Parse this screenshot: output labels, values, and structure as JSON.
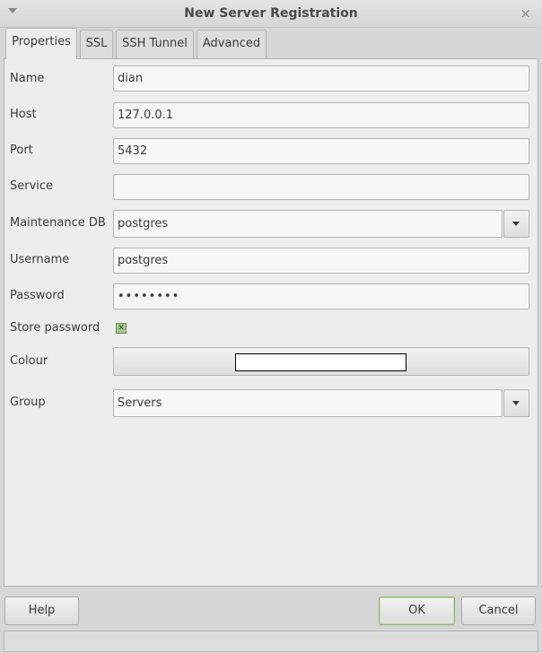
{
  "window": {
    "title": "New Server Registration",
    "close_glyph": "×"
  },
  "tabs": [
    {
      "label": "Properties",
      "active": true
    },
    {
      "label": "SSL",
      "active": false
    },
    {
      "label": "SSH Tunnel",
      "active": false
    },
    {
      "label": "Advanced",
      "active": false
    }
  ],
  "form": {
    "name": {
      "label": "Name",
      "value": "dian"
    },
    "host": {
      "label": "Host",
      "value": "127.0.0.1"
    },
    "port": {
      "label": "Port",
      "value": "5432"
    },
    "service": {
      "label": "Service",
      "value": ""
    },
    "maintenance_db": {
      "label": "Maintenance DB",
      "value": "postgres"
    },
    "username": {
      "label": "Username",
      "value": "postgres"
    },
    "password": {
      "label": "Password",
      "value": "••••••••"
    },
    "store_password": {
      "label": "Store password",
      "checked": true,
      "glyph": "✕"
    },
    "colour": {
      "label": "Colour",
      "value": "#ffffff"
    },
    "group": {
      "label": "Group",
      "value": "Servers"
    }
  },
  "buttons": {
    "help": "Help",
    "ok": "OK",
    "cancel": "Cancel"
  },
  "colors": {
    "checkbox_fill": "#a9c48e",
    "default_button_border": "#8fb070",
    "swatch": "#ffffff"
  }
}
